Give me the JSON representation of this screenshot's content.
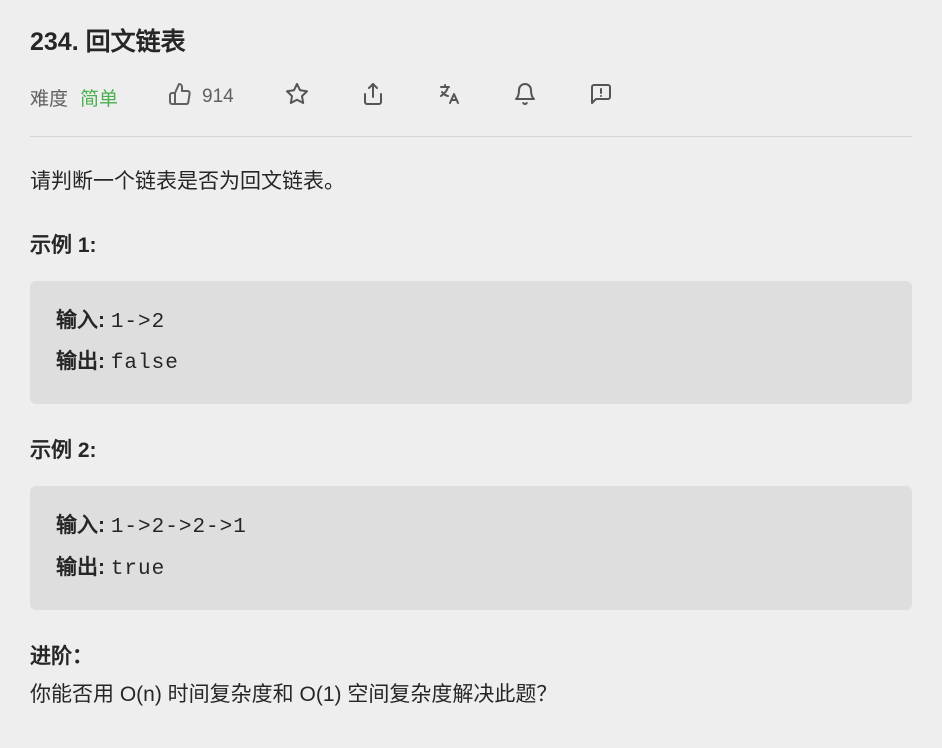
{
  "title": "234. 回文链表",
  "meta": {
    "difficulty_label": "难度",
    "difficulty_value": "简单",
    "likes": "914"
  },
  "description": "请判断一个链表是否为回文链表。",
  "examples": [
    {
      "title": "示例 1:",
      "input_label": "输入: ",
      "input_value": "1->2",
      "output_label": "输出: ",
      "output_value": "false"
    },
    {
      "title": "示例 2:",
      "input_label": "输入: ",
      "input_value": "1->2->2->1",
      "output_label": "输出: ",
      "output_value": "true"
    }
  ],
  "advanced": {
    "title": "进阶：",
    "text": "你能否用 O(n) 时间复杂度和 O(1) 空间复杂度解决此题？"
  }
}
